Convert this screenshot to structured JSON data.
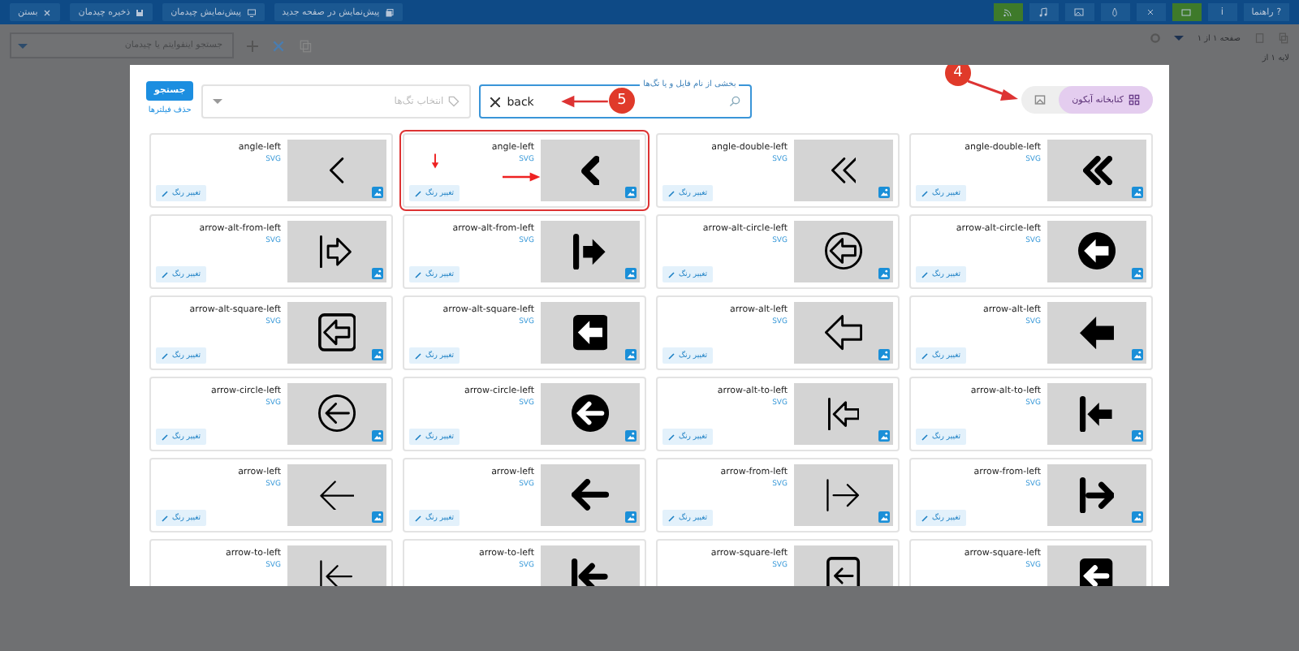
{
  "top_bar": {
    "help": {
      "label": "راهنما",
      "mark": "?"
    },
    "info": "i",
    "tool_buttons": [
      {
        "on": true
      },
      {
        "on": false
      },
      {
        "on": false
      },
      {
        "on": false
      },
      {
        "on": false
      },
      {
        "on": true
      }
    ],
    "actions": [
      {
        "label": "پیش‌نمایش در صفحه جدید"
      },
      {
        "label": "پیش‌نمایش چیدمان"
      },
      {
        "label": "ذخیره چیدمان"
      },
      {
        "label": "بستن"
      }
    ]
  },
  "toolbar": {
    "page": "صفحه ۱ از ۱",
    "layer": "لایه ۱ از",
    "search": {
      "placeholder": "جستجو اینفوایتم یا چیدمان"
    }
  },
  "modal": {
    "search_button": "جستجو",
    "clear_filters": "حذف فیلترها",
    "tags_select": {
      "placeholder": "انتخاب تگ‌ها"
    },
    "search": {
      "label": "بخشی از نام فایل و یا تگ‌ها",
      "value": "back"
    },
    "sources": [
      {
        "kind": "icons",
        "label": "کتابخانه آیکون",
        "selected": true
      },
      {
        "kind": "image",
        "selected": false
      }
    ],
    "icons": [
      {
        "name": "angle-double-left",
        "format": "SVG",
        "button": "تغییر رنگ",
        "highlighted": false
      },
      {
        "name": "angle-double-left",
        "format": "SVG",
        "button": "تغییر رنگ",
        "highlighted": false
      },
      {
        "name": "angle-left",
        "format": "SVG",
        "button": "تغییر رنگ",
        "highlighted": true
      },
      {
        "name": "angle-left",
        "format": "SVG",
        "button": "تغییر رنگ",
        "highlighted": false
      },
      {
        "name": "arrow-alt-circle-left",
        "format": "SVG",
        "button": "تغییر رنگ",
        "highlighted": false
      },
      {
        "name": "arrow-alt-circle-left",
        "format": "SVG",
        "button": "تغییر رنگ",
        "highlighted": false
      },
      {
        "name": "arrow-alt-from-left",
        "format": "SVG",
        "button": "تغییر رنگ",
        "highlighted": false
      },
      {
        "name": "arrow-alt-from-left",
        "format": "SVG",
        "button": "تغییر رنگ",
        "highlighted": false
      },
      {
        "name": "arrow-alt-left",
        "format": "SVG",
        "button": "تغییر رنگ",
        "highlighted": false
      },
      {
        "name": "arrow-alt-left",
        "format": "SVG",
        "button": "تغییر رنگ",
        "highlighted": false
      },
      {
        "name": "arrow-alt-square-left",
        "format": "SVG",
        "button": "تغییر رنگ",
        "highlighted": false
      },
      {
        "name": "arrow-alt-square-left",
        "format": "SVG",
        "button": "تغییر رنگ",
        "highlighted": false
      },
      {
        "name": "arrow-alt-to-left",
        "format": "SVG",
        "button": "تغییر رنگ",
        "highlighted": false
      },
      {
        "name": "arrow-alt-to-left",
        "format": "SVG",
        "button": "تغییر رنگ",
        "highlighted": false
      },
      {
        "name": "arrow-circle-left",
        "format": "SVG",
        "button": "تغییر رنگ",
        "highlighted": false
      },
      {
        "name": "arrow-circle-left",
        "format": "SVG",
        "button": "تغییر رنگ",
        "highlighted": false
      },
      {
        "name": "arrow-from-left",
        "format": "SVG",
        "button": "تغییر رنگ",
        "highlighted": false
      },
      {
        "name": "arrow-from-left",
        "format": "SVG",
        "button": "تغییر رنگ",
        "highlighted": false
      },
      {
        "name": "arrow-left",
        "format": "SVG",
        "button": "تغییر رنگ",
        "highlighted": false
      },
      {
        "name": "arrow-left",
        "format": "SVG",
        "button": "تغییر رنگ",
        "highlighted": false
      },
      {
        "name": "arrow-square-left",
        "format": "SVG",
        "highlighted": false
      },
      {
        "name": "arrow-square-left",
        "format": "SVG",
        "highlighted": false
      },
      {
        "name": "arrow-to-left",
        "format": "SVG",
        "highlighted": false
      },
      {
        "name": "arrow-to-left",
        "format": "SVG",
        "highlighted": false
      }
    ]
  },
  "callouts": [
    {
      "label": "4"
    },
    {
      "label": "5"
    }
  ]
}
